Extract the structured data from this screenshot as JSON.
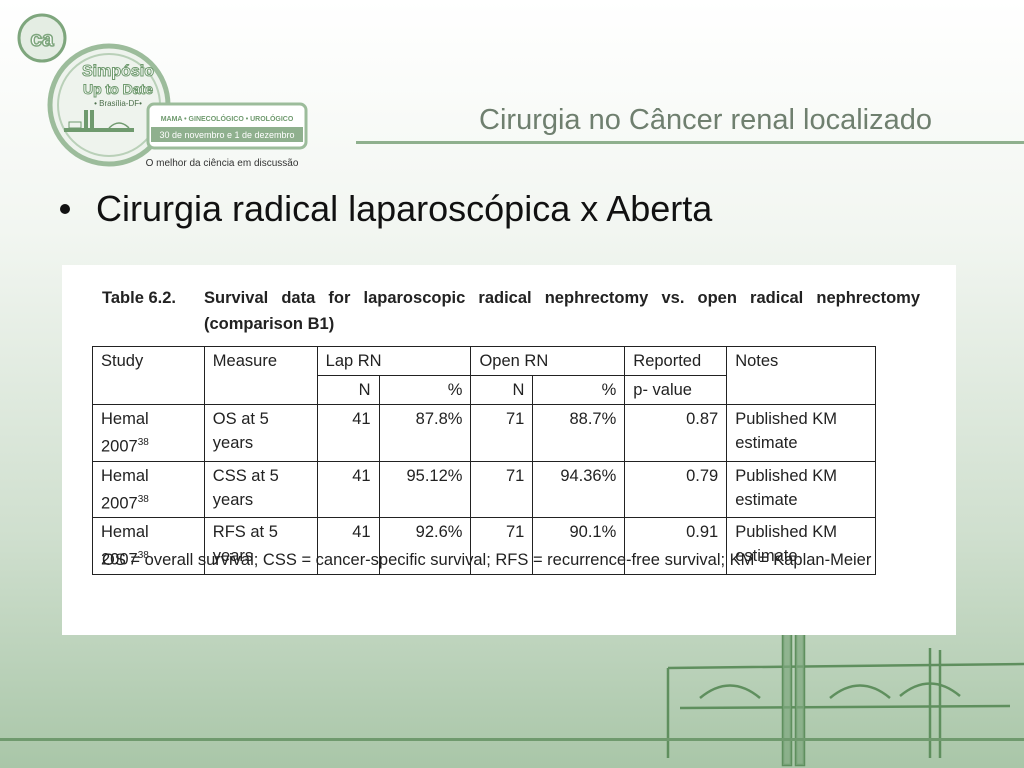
{
  "logo": {
    "badge_text": "ca",
    "line1": "Simpósio",
    "line2": "Up to Date",
    "line3": "• Brasília-DF•",
    "specialties": "MAMA • GINECOLÓGICO • UROLÓGICO",
    "dates": "30 de novembro e 1 de dezembro",
    "tagline": "O melhor da ciência em discussão"
  },
  "header": {
    "title": "Cirurgia no Câncer renal localizado"
  },
  "bullet": {
    "text": "Cirurgia radical laparoscópica x Aberta"
  },
  "table": {
    "caption_number": "Table 6.2.",
    "caption_text": "Survival data for laparoscopic radical nephrectomy vs. open radical nephrectomy (comparison B1)",
    "headers": {
      "study": "Study",
      "measure": "Measure",
      "lap_rn": "Lap RN",
      "open_rn": "Open RN",
      "reported": "Reported",
      "p_value": "p- value",
      "notes": "Notes",
      "n": "N",
      "pct": "%"
    },
    "rows": [
      {
        "study": "Hemal 2007",
        "ref": "38",
        "measure": "OS at 5 years",
        "lap_n": "41",
        "lap_pct": "87.8%",
        "open_n": "71",
        "open_pct": "88.7%",
        "p": "0.87",
        "notes": "Published KM estimate"
      },
      {
        "study": "Hemal 2007",
        "ref": "38",
        "measure": "CSS at 5 years",
        "lap_n": "41",
        "lap_pct": "95.12%",
        "open_n": "71",
        "open_pct": "94.36%",
        "p": "0.79",
        "notes": "Published KM estimate"
      },
      {
        "study": "Hemal 2007",
        "ref": "38",
        "measure": "RFS at 5 years",
        "lap_n": "41",
        "lap_pct": "92.6%",
        "open_n": "71",
        "open_pct": "90.1%",
        "p": "0.91",
        "notes": "Published KM estimate"
      }
    ],
    "footnote": "OS = overall survival; CSS = cancer-specific survival; RFS = recurrence-free survival; KM = Kaplan-Meier"
  },
  "colors": {
    "accent_green": "#8fb08e",
    "dark_green": "#5f8f5e"
  }
}
